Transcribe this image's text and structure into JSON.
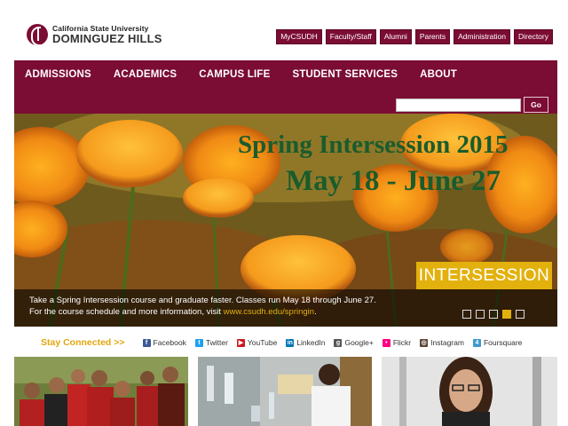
{
  "header": {
    "logo_line1": "California State University",
    "logo_line2": "DOMINGUEZ HILLS",
    "quick_links": [
      "MyCSUDH",
      "Faculty/Staff",
      "Alumni",
      "Parents",
      "Administration",
      "Directory"
    ]
  },
  "nav": {
    "items": [
      "ADMISSIONS",
      "ACADEMICS",
      "CAMPUS LIFE",
      "STUDENT SERVICES",
      "ABOUT"
    ],
    "search_value": "",
    "search_button": "Go"
  },
  "hero": {
    "title": "Spring Intersession 2015",
    "subtitle": "May 18 - June 27",
    "badge": "INTERSESSION",
    "caption_line1": "Take a Spring Intersession course and graduate faster. Classes run May 18 through June 27.",
    "caption_line2_prefix": "For the course schedule and more information, visit ",
    "caption_link": "www.csudh.edu/springin",
    "caption_line2_suffix": ".",
    "slides_total": 5,
    "active_slide": 4
  },
  "social": {
    "heading": "Stay Connected >>",
    "items": [
      {
        "label": "Facebook",
        "icon": "facebook-icon",
        "color": "#3b5998"
      },
      {
        "label": "Twitter",
        "icon": "twitter-icon",
        "color": "#1da1f2"
      },
      {
        "label": "YouTube",
        "icon": "youtube-icon",
        "color": "#cc181e"
      },
      {
        "label": "LinkedIn",
        "icon": "linkedin-icon",
        "color": "#0077b5"
      },
      {
        "label": "Google+",
        "icon": "googleplus-icon",
        "color": "#555555"
      },
      {
        "label": "Flickr",
        "icon": "flickr-icon",
        "color": "#ff0084"
      },
      {
        "label": "Instagram",
        "icon": "instagram-icon",
        "color": "#5b4637"
      },
      {
        "label": "Foursquare",
        "icon": "foursquare-icon",
        "color": "#3d9ad1"
      }
    ]
  },
  "colors": {
    "brand": "#7b0c34",
    "accent": "#e2b10d",
    "title_green": "#1a5c2c"
  }
}
